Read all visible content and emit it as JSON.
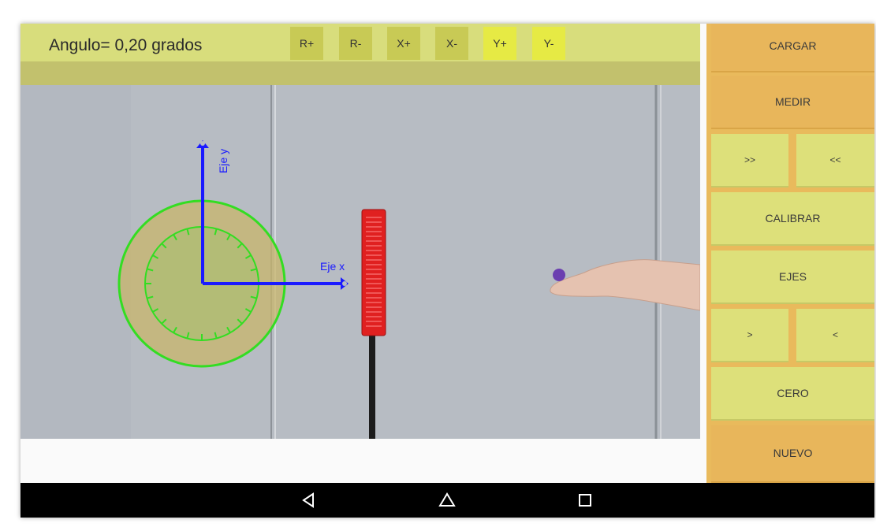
{
  "toolbar": {
    "angle_text": "Angulo= 0,20 grados",
    "buttons": [
      "R+",
      "R-",
      "X+",
      "X-",
      "Y+",
      "Y-"
    ]
  },
  "overlay": {
    "axis_y_label": "Eje y",
    "axis_x_label": "Eje x",
    "axis_color": "#1a1aff",
    "circle_color": "#33dd22"
  },
  "panel": {
    "cargar": "CARGAR",
    "medir": "MEDIR",
    "fast_forward": ">>",
    "fast_back": "<<",
    "calibrar": "CALIBRAR",
    "ejes": "EJES",
    "step_forward": ">",
    "step_back": "<",
    "cero": "CERO",
    "nuevo": "NUEVO"
  },
  "colors": {
    "panel_orange": "#e8b65b",
    "panel_yellow": "#dde07a",
    "toolbar": "#d8dd7c"
  },
  "nav": {
    "icons": [
      "back-icon",
      "home-icon",
      "recents-icon"
    ]
  }
}
